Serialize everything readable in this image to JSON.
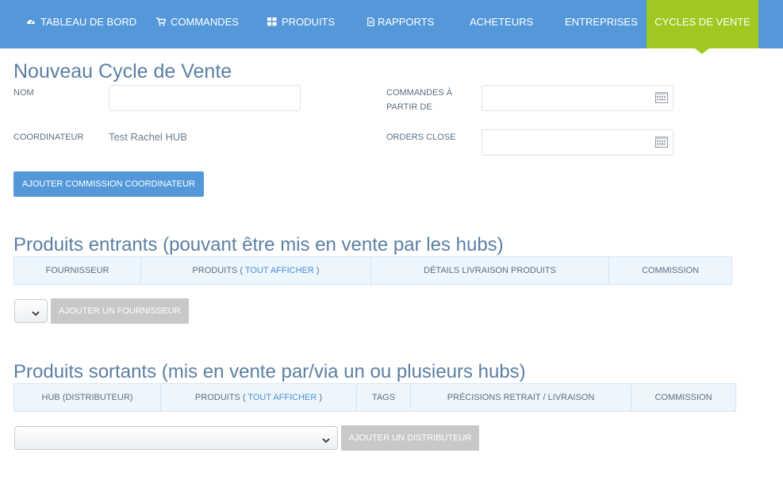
{
  "nav": {
    "items": [
      {
        "label": "TABLEAU DE BORD",
        "icon": "dashboard-icon"
      },
      {
        "label": "COMMANDES",
        "icon": "cart-icon"
      },
      {
        "label": "PRODUITS",
        "icon": "grid-icon"
      },
      {
        "label": "RAPPORTS",
        "icon": "document-icon"
      },
      {
        "label": "ACHETEURS"
      },
      {
        "label": "ENTREPRISES"
      },
      {
        "label": "CYCLES DE VENTE",
        "active": true
      }
    ],
    "active_color": "#9fc820",
    "bar_color": "#5498da"
  },
  "page": {
    "title": "Nouveau Cycle de Vente"
  },
  "form": {
    "nom_label": "NOM",
    "nom_value": "",
    "coordinateur_label": "COORDINATEUR",
    "coordinateur_value": "Test Rachel HUB",
    "commandes_label_line1": "COMMANDES À",
    "commandes_label_line2": "PARTIR DE",
    "commandes_value": "",
    "orders_close_label": "ORDERS CLOSE",
    "orders_close_value": "",
    "add_commission_button": "AJOUTER COMMISSION COORDINATEUR"
  },
  "incoming": {
    "title": "Produits entrants (pouvant être mis en vente par les hubs)",
    "columns": {
      "fournisseur": "FOURNISSEUR",
      "produits": "PRODUITS (",
      "produits_link": "TOUT AFFICHER",
      "produits_close": ")",
      "details": "DÉTAILS LIVRAISON PRODUITS",
      "commission": "COMMISSION"
    },
    "select_value": "",
    "add_button": "AJOUTER UN FOURNISSEUR"
  },
  "outgoing": {
    "title": "Produits sortants (mis en vente par/via un ou plusieurs hubs)",
    "columns": {
      "hub": "HUB (DISTRIBUTEUR)",
      "produits": "PRODUITS (",
      "produits_link": "TOUT AFFICHER",
      "produits_close": ")",
      "tags": "TAGS",
      "precisions": "PRÉCISIONS RETRAIT / LIVRAISON",
      "commission": "COMMISSION"
    },
    "select_value": "",
    "add_button": "AJOUTER UN DISTRIBUTEUR"
  }
}
